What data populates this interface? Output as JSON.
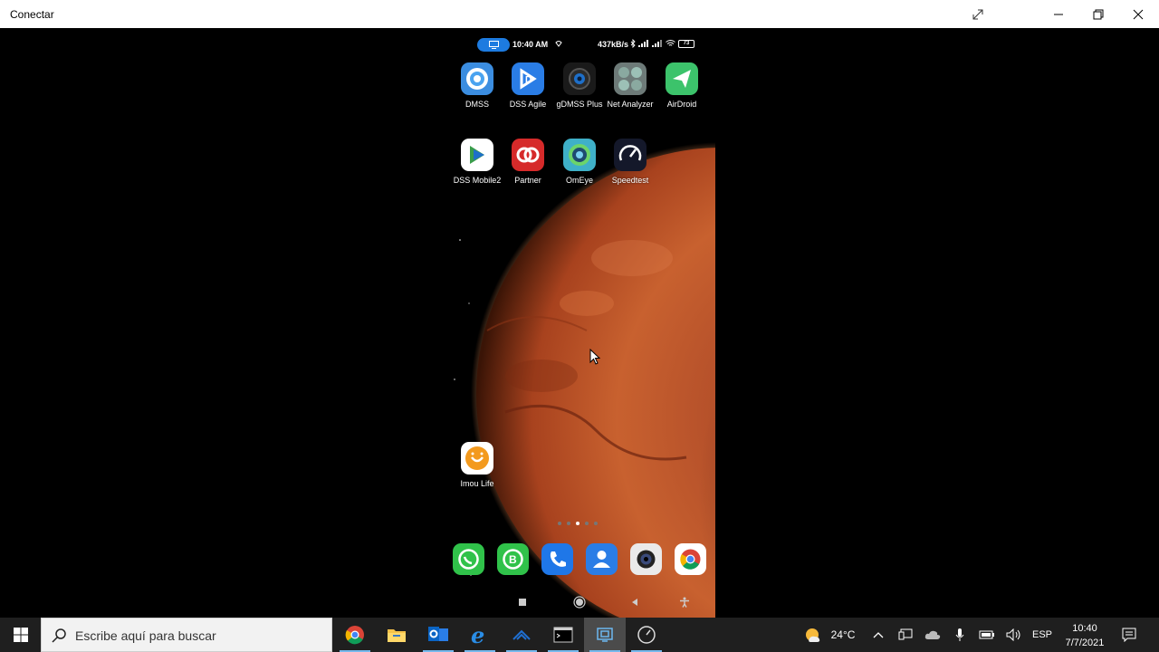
{
  "window": {
    "title": "Conectar",
    "controls": [
      "expand-icon",
      "minimize-icon",
      "restore-icon",
      "close-icon"
    ]
  },
  "phone": {
    "status_bar": {
      "time": "10:40 AM",
      "speed": "437kB/s",
      "battery": "73"
    },
    "apps": [
      {
        "label": "DMSS",
        "icon": "dmss-icon"
      },
      {
        "label": "DSS Agile",
        "icon": "dss-agile-icon"
      },
      {
        "label": "gDMSS Plus",
        "icon": "gdmss-plus-icon"
      },
      {
        "label": "Net Analyzer",
        "icon": "net-analyzer-icon"
      },
      {
        "label": "AirDroid",
        "icon": "airdroid-icon"
      },
      {
        "label": "DSS Mobile2",
        "icon": "dss-mobile2-icon"
      },
      {
        "label": "Partner",
        "icon": "partner-icon"
      },
      {
        "label": "OmEye",
        "icon": "omeye-icon"
      },
      {
        "label": "Speedtest",
        "icon": "speedtest-icon"
      },
      {
        "label": "Imou Life",
        "icon": "imou-life-icon"
      }
    ],
    "page_dots": {
      "count": 5,
      "active": 3
    },
    "dock": [
      "whatsapp-icon",
      "whatsapp-business-icon",
      "phone-icon",
      "contacts-icon",
      "camera-icon",
      "chrome-icon"
    ],
    "nav": [
      "recents-icon",
      "home-icon",
      "back-icon",
      "accessibility-icon"
    ]
  },
  "taskbar": {
    "search_placeholder": "Escribe aquí para buscar",
    "apps": [
      "chrome-icon",
      "file-explorer-icon",
      "outlook-icon",
      "edge-icon",
      "app-icon",
      "terminal-icon",
      "remote-connect-icon",
      "clock-app-icon"
    ],
    "weather": "24°C",
    "language": "ESP",
    "time": "10:40",
    "date": "7/7/2021"
  },
  "colors": {
    "titlebar": "#ffffff",
    "taskbar": "#1f1f1f",
    "accent": "#76b9ed",
    "mars": "#c0532a"
  }
}
